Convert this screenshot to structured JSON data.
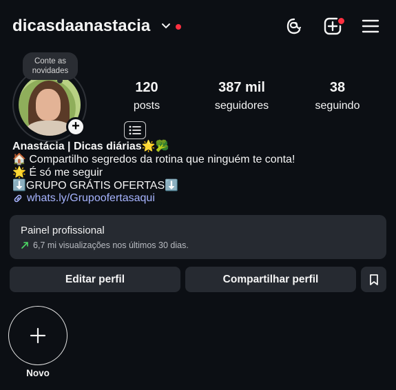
{
  "header": {
    "username": "dicasdaanastacia",
    "icons": [
      "chevron-down-icon",
      "threads-icon",
      "add-post-icon",
      "menu-icon"
    ]
  },
  "profile": {
    "note_lines": [
      "Conte as",
      "novidades"
    ],
    "stats": [
      {
        "value": "120",
        "label": "posts"
      },
      {
        "value": "387 mil",
        "label": "seguidores"
      },
      {
        "value": "38",
        "label": "seguindo"
      }
    ]
  },
  "bio": {
    "name": "Anastácia | Dicas diárias🌟🥦",
    "line1": "🏠 Compartilho segredos da rotina que ninguém te conta!",
    "line2": "🌟 É só me seguir",
    "line3": "⬇️GRUPO GRÁTIS OFERTAS⬇️",
    "link": "whats.ly/Grupoofertasaqui"
  },
  "panel": {
    "title": "Painel profissional",
    "subtitle": "6,7 mi visualizações nos últimos 30 dias."
  },
  "actions": {
    "edit": "Editar perfil",
    "share": "Compartilhar perfil"
  },
  "highlights": {
    "new_label": "Novo"
  },
  "colors": {
    "background": "#0c0f14",
    "surface": "#262a31",
    "link": "#a7b4ff",
    "notification": "#ff3040",
    "trend": "#4cd964"
  }
}
